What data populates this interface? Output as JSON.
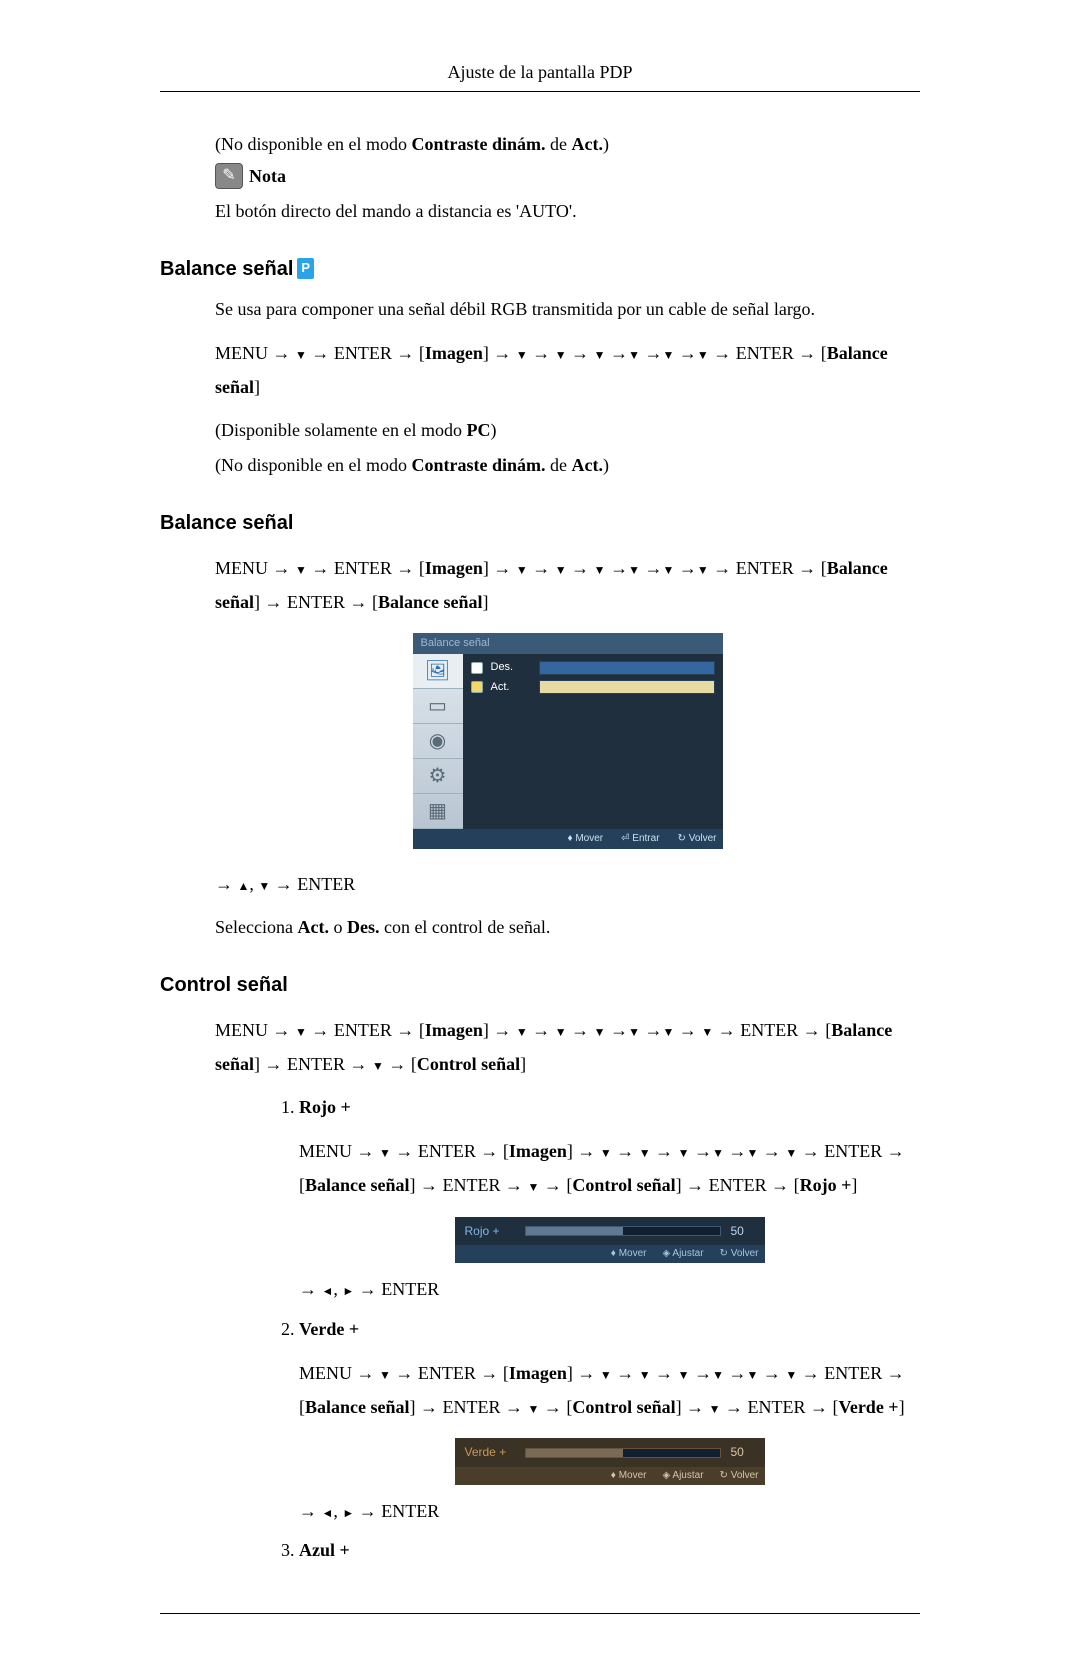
{
  "header": {
    "title": "Ajuste de la pantalla PDP"
  },
  "intro": {
    "not_available_prefix": "(No disponible en el modo ",
    "not_available_bold": "Contraste dinám.",
    "not_available_mid": " de ",
    "not_available_act": "Act.",
    "not_available_suffix": ")",
    "nota_label": "Nota",
    "nota_text": "El botón directo del mando a distancia es 'AUTO'."
  },
  "section1": {
    "heading": "Balance señal",
    "badge": "P",
    "desc": "Se usa para componer una señal débil RGB transmitida por un cable de señal largo.",
    "path": {
      "menu": "MENU",
      "enter": "ENTER",
      "imagen": "Imagen",
      "balance": "Balance señal"
    },
    "avail_prefix": "(Disponible solamente en el modo ",
    "avail_bold": "PC",
    "avail_suffix": ")",
    "not_available_prefix": "(No disponible en el modo ",
    "not_available_bold": "Contraste dinám.",
    "not_available_mid": " de ",
    "not_available_act": "Act.",
    "not_available_suffix": ")"
  },
  "section2": {
    "heading": "Balance señal",
    "path": {
      "menu": "MENU",
      "enter": "ENTER",
      "imagen": "Imagen",
      "balance": "Balance señal"
    },
    "osd": {
      "title": "Balance señal",
      "opt1": "Des.",
      "opt2": "Act.",
      "footer_move": "Mover",
      "footer_enter": "Entrar",
      "footer_back": "Volver"
    },
    "nav_after": "ENTER",
    "select_prefix": "Selecciona ",
    "select_act": "Act.",
    "select_mid": " o ",
    "select_des": "Des.",
    "select_suffix": " con el control de señal."
  },
  "section3": {
    "heading": "Control señal",
    "path": {
      "menu": "MENU",
      "enter": "ENTER",
      "imagen": "Imagen",
      "balance": "Balance señal",
      "control": "Control señal"
    },
    "items": [
      {
        "title": "Rojo +",
        "osd_label": "Rojo +",
        "osd_value": "50",
        "footer_move": "Mover",
        "footer_adjust": "Ajustar",
        "footer_back": "Volver",
        "nav_after": "ENTER"
      },
      {
        "title": "Verde +",
        "osd_label": "Verde +",
        "osd_value": "50",
        "footer_move": "Mover",
        "footer_adjust": "Ajustar",
        "footer_back": "Volver",
        "nav_after": "ENTER"
      },
      {
        "title": "Azul +"
      }
    ]
  },
  "glyphs": {
    "arrow": "→",
    "down": "▼",
    "up": "▲",
    "left": "◄",
    "right": "►",
    "comma": ", "
  }
}
